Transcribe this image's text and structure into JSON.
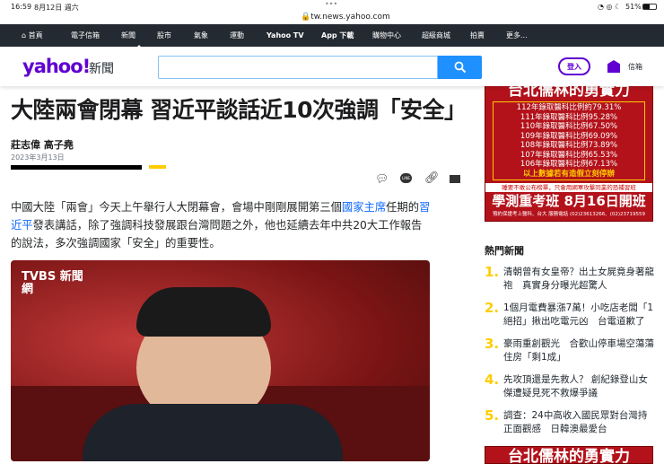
{
  "status": {
    "time": "16:59",
    "date": "8月12日 週六",
    "battery": "51%",
    "url": "tw.news.yahoo.com"
  },
  "nav": [
    {
      "label": "首頁"
    },
    {
      "label": "電子信箱"
    },
    {
      "label": "新聞"
    },
    {
      "label": "股市"
    },
    {
      "label": "氣象"
    },
    {
      "label": "運動"
    },
    {
      "label": "Yahoo TV"
    },
    {
      "label": "App 下載"
    },
    {
      "label": "購物中心"
    },
    {
      "label": "超級商城"
    },
    {
      "label": "拍賣"
    },
    {
      "label": "更多..."
    }
  ],
  "header": {
    "logo": "yahoo!",
    "section": "新聞",
    "search_placeholder": "",
    "login": "登入",
    "mail": "信箱"
  },
  "article": {
    "title": "大陸兩會閉幕 習近平談話近10次強調「安全」",
    "authors": "莊志偉 高子堯",
    "date": "2023年3月13日",
    "p1a": "中國大陸「兩會」今天上午舉行人大閉幕會，會場中剛剛展開第三個",
    "link1": "國家主席",
    "p1b": "任期的",
    "link2": "習近平",
    "p1c": "發表講話，除了強調科技發展跟台灣問題之外，他也延續去年中共20大工作報告的說法，多次強調國家「安全」的重要性。",
    "image_watermark": "TVBS 新聞網"
  },
  "ad": {
    "title": "台北儒林的勇實力",
    "lines": [
      "112年錄取醫科比例約79.31%",
      "111年錄取醫科比例95.28%",
      "110年錄取醫科比例67.50%",
      "109年錄取醫科比例69.09%",
      "108年錄取醫科比例73.89%",
      "107年錄取醫科比例65.53%",
      "106年錄取醫科比例67.13%"
    ],
    "warn": "以上數據若有造假立刻停辦",
    "note": "睡要不敢公布榜單，只會用網軍攻擊同業的恐補習班",
    "big": "學測重考班 8月16日開班",
    "small": "預約保證考上醫科、台大 服務電話 (02)23613266、(02)23719559"
  },
  "hot": {
    "title": "熱門新聞",
    "items": [
      {
        "n": "1.",
        "t": "清朝曾有女皇帝？出土女屍竟身著龍袍　真實身分曝光超驚人"
      },
      {
        "n": "2.",
        "t": "1個月電費暴漲7萬！小吃店老闆「1絕招」揪出吃電元凶　台電道歉了"
      },
      {
        "n": "3.",
        "t": "豪雨重創觀光　合歡山停車場空蕩蕩　住房「剩1成」"
      },
      {
        "n": "4.",
        "t": "先攻頂還是先救人？ 創紀錄登山女傑遭疑見死不救爆爭議"
      },
      {
        "n": "5.",
        "t": "調查：24中高收入國民眾對台灣持正面觀感　日韓澳最愛台"
      }
    ]
  },
  "colors": {
    "brand": "#6001d2",
    "nav": "#232a31",
    "accent": "#fc0",
    "link": "#0f69ff"
  }
}
